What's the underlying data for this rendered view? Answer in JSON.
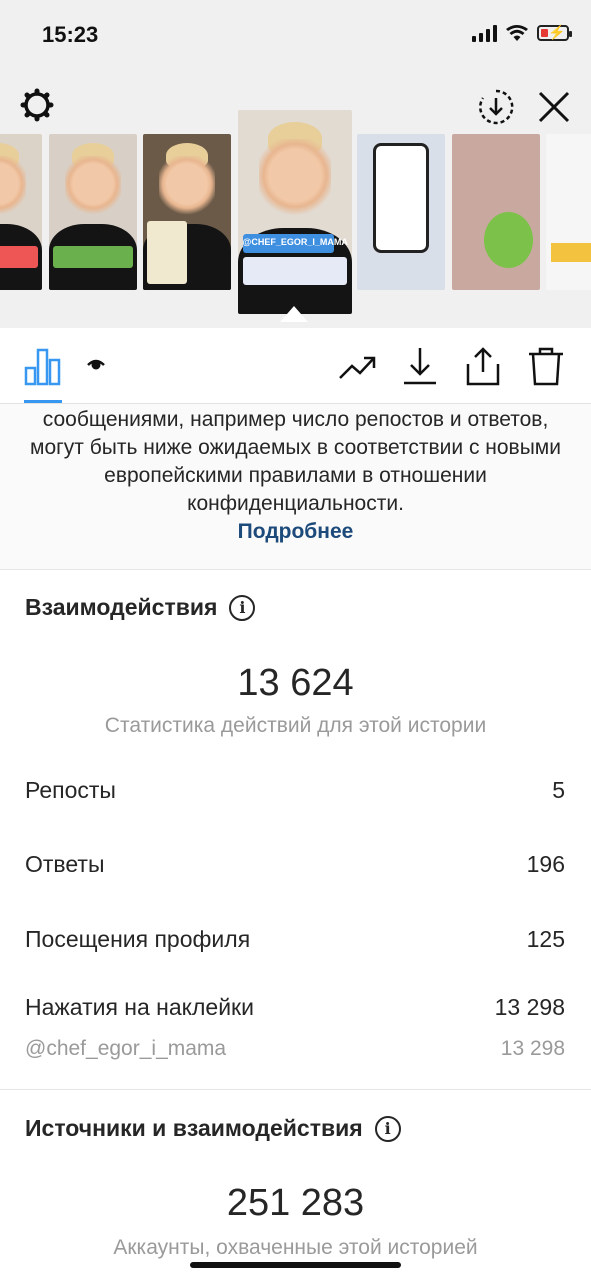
{
  "status": {
    "time": "15:23"
  },
  "colors": {
    "accent": "#3897f0",
    "link": "#1c4a7a",
    "muted": "#9a9a9a"
  },
  "thumbnails": {
    "selected_tag": "@CHEF_EGOR_I_MAMA"
  },
  "toolbar": {
    "icons": [
      "insights-icon",
      "eye-icon",
      "trending-icon",
      "download-icon",
      "share-icon",
      "trash-icon"
    ]
  },
  "notice": {
    "text": "сообщениями, например число репостов и ответов, могут быть ниже ожидаемых в соответствии с новыми европейскими правилами в отношении конфиденциальности.",
    "link": "Подробнее"
  },
  "interactions": {
    "title": "Взаимодействия",
    "total": "13 624",
    "subtitle": "Статистика действий для этой истории",
    "rows": [
      {
        "label": "Репосты",
        "value": "5"
      },
      {
        "label": "Ответы",
        "value": "196"
      },
      {
        "label": "Посещения профиля",
        "value": "125"
      },
      {
        "label": "Нажатия на наклейки",
        "value": "13 298"
      }
    ],
    "sticker_detail": {
      "label": "@chef_egor_i_mama",
      "value": "13 298"
    }
  },
  "reach": {
    "title": "Источники и взаимодействия",
    "total": "251 283",
    "subtitle": "Аккаунты, охваченные этой историей"
  }
}
